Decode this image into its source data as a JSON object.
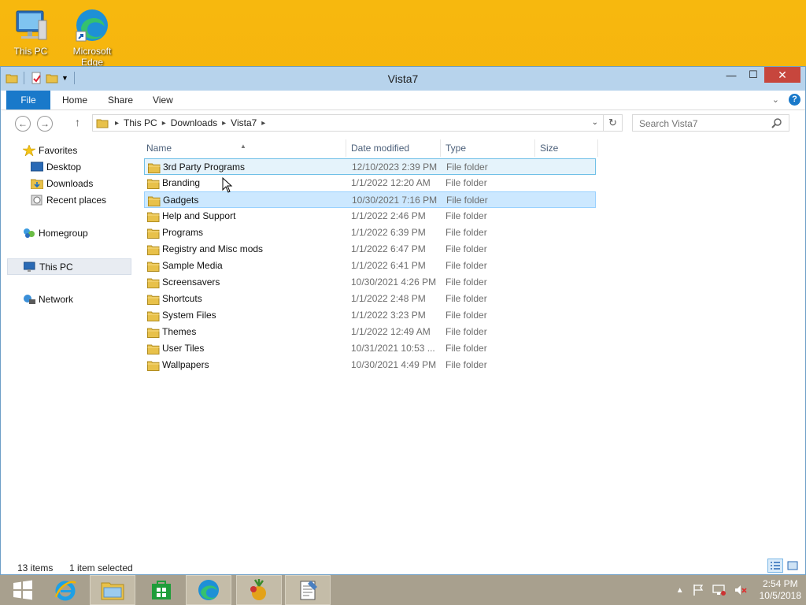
{
  "desktop": {
    "icons": [
      {
        "label": "This PC",
        "icon": "this-pc-icon"
      },
      {
        "label": "Microsoft Edge",
        "icon": "edge-icon"
      }
    ]
  },
  "window": {
    "title": "Vista7",
    "controls": {
      "minimize": "—",
      "maximize": "☐",
      "close": "✕"
    }
  },
  "ribbon": {
    "tabs": [
      "File",
      "Home",
      "Share",
      "View"
    ],
    "help": "?"
  },
  "address": {
    "crumbs": [
      "This PC",
      "Downloads",
      "Vista7"
    ]
  },
  "search": {
    "placeholder": "Search Vista7"
  },
  "navpane": {
    "favorites": "Favorites",
    "desktop": "Desktop",
    "downloads": "Downloads",
    "recent": "Recent places",
    "homegroup": "Homegroup",
    "thispc": "This PC",
    "network": "Network"
  },
  "columns": {
    "name": "Name",
    "date": "Date modified",
    "type": "Type",
    "size": "Size"
  },
  "files": [
    {
      "name": "3rd Party Programs",
      "date": "12/10/2023 2:39 PM",
      "type": "File folder",
      "size": "",
      "state": "hover"
    },
    {
      "name": "Branding",
      "date": "1/1/2022 12:20 AM",
      "type": "File folder",
      "size": "",
      "state": ""
    },
    {
      "name": "Gadgets",
      "date": "10/30/2021 7:16 PM",
      "type": "File folder",
      "size": "",
      "state": "sel"
    },
    {
      "name": "Help and Support",
      "date": "1/1/2022 2:46 PM",
      "type": "File folder",
      "size": "",
      "state": ""
    },
    {
      "name": "Programs",
      "date": "1/1/2022 6:39 PM",
      "type": "File folder",
      "size": "",
      "state": ""
    },
    {
      "name": "Registry and Misc mods",
      "date": "1/1/2022 6:47 PM",
      "type": "File folder",
      "size": "",
      "state": ""
    },
    {
      "name": "Sample Media",
      "date": "1/1/2022 6:41 PM",
      "type": "File folder",
      "size": "",
      "state": ""
    },
    {
      "name": "Screensavers",
      "date": "10/30/2021 4:26 PM",
      "type": "File folder",
      "size": "",
      "state": ""
    },
    {
      "name": "Shortcuts",
      "date": "1/1/2022 2:48 PM",
      "type": "File folder",
      "size": "",
      "state": ""
    },
    {
      "name": "System Files",
      "date": "1/1/2022 3:23 PM",
      "type": "File folder",
      "size": "",
      "state": ""
    },
    {
      "name": "Themes",
      "date": "1/1/2022 12:49 AM",
      "type": "File folder",
      "size": "",
      "state": ""
    },
    {
      "name": "User Tiles",
      "date": "10/31/2021 10:53 ...",
      "type": "File folder",
      "size": "",
      "state": ""
    },
    {
      "name": "Wallpapers",
      "date": "10/30/2021 4:49 PM",
      "type": "File folder",
      "size": "",
      "state": ""
    }
  ],
  "status": {
    "count": "13 items",
    "selected": "1 item selected"
  },
  "taskbar": {
    "apps": [
      "start-icon",
      "internet-explorer-icon",
      "file-explorer-icon",
      "store-icon",
      "edge-icon",
      "media-app-icon",
      "notepad-icon"
    ],
    "clock_time": "2:54 PM",
    "clock_date": "10/5/2018"
  }
}
